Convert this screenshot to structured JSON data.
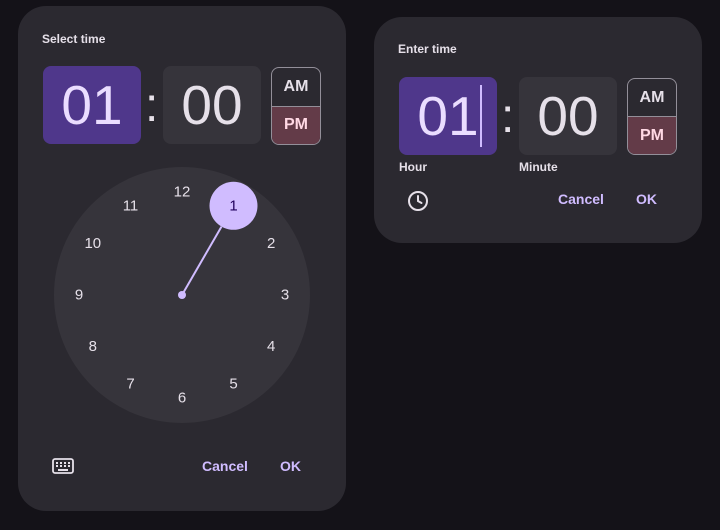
{
  "picker": {
    "title": "Select time",
    "hour": "01",
    "separator": ":",
    "minute": "00",
    "am_label": "AM",
    "pm_label": "PM",
    "selected_period": "PM",
    "dial_numbers": [
      "12",
      "1",
      "2",
      "3",
      "4",
      "5",
      "6",
      "7",
      "8",
      "9",
      "10",
      "11"
    ],
    "selected_hour_number": "1",
    "mode_toggle_icon": "keyboard-icon",
    "cancel_label": "Cancel",
    "ok_label": "OK"
  },
  "input": {
    "title": "Enter time",
    "hour": "01",
    "separator": ":",
    "minute": "00",
    "hour_label": "Hour",
    "minute_label": "Minute",
    "am_label": "AM",
    "pm_label": "PM",
    "selected_period": "PM",
    "mode_toggle_icon": "clock-icon",
    "cancel_label": "Cancel",
    "ok_label": "OK"
  },
  "colors": {
    "background": "#141218",
    "surface": "#2b2930",
    "selected": "#4f378b",
    "accent": "#d0bcff",
    "pm_selected": "#633b48"
  }
}
